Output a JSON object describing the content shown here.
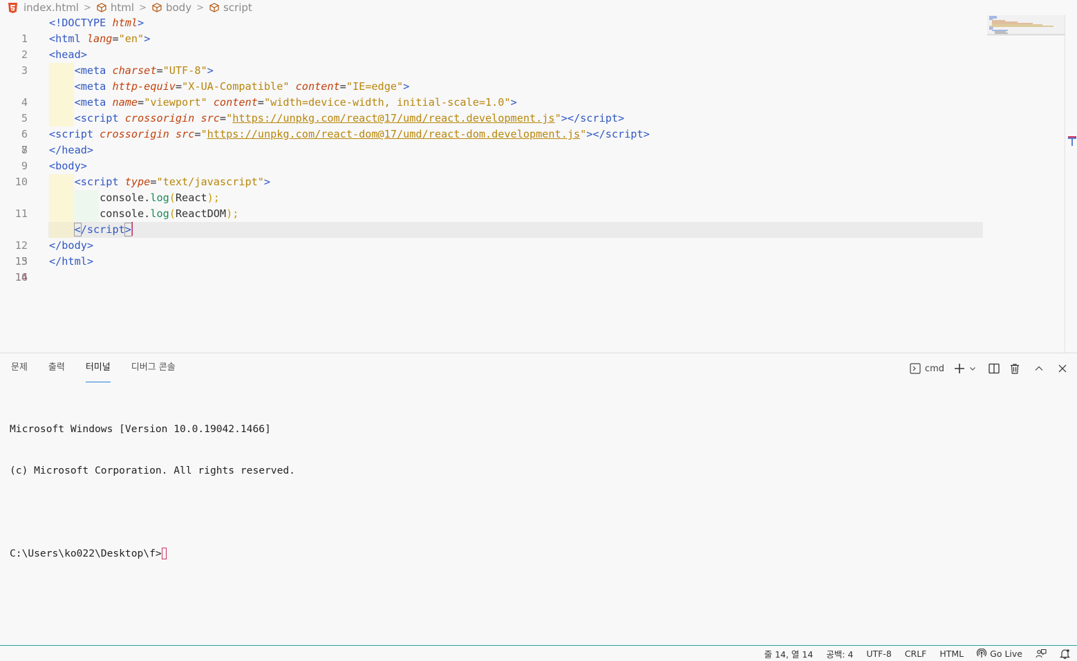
{
  "breadcrumb": {
    "file": "index.html",
    "items": [
      "html",
      "body",
      "script"
    ]
  },
  "editor": {
    "active_line": 14,
    "line_numbers": [
      "1",
      "2",
      "3",
      "4",
      "5",
      "6",
      "7",
      "8",
      "9",
      "10",
      "11",
      "12",
      "13",
      "14",
      "15",
      "16"
    ]
  },
  "panel": {
    "tabs": [
      "문제",
      "출력",
      "터미널",
      "디버그 콘솔"
    ],
    "active_tab": "터미널",
    "shell_name": "cmd",
    "terminal_lines": [
      "Microsoft Windows [Version 10.0.19042.1466]",
      "(c) Microsoft Corporation. All rights reserved.",
      "",
      "C:\\Users\\ko022\\Desktop\\f>"
    ]
  },
  "statusbar": {
    "position": "줄 14, 열 14",
    "indent": "공백: 4",
    "encoding": "UTF-8",
    "eol": "CRLF",
    "language": "HTML",
    "go_live": "Go Live"
  },
  "colors": {
    "tag": "#2f57c4",
    "attribute": "#c2410c",
    "string": "#b8860b",
    "active_line_number": "#c0306a",
    "status_border": "#2aa198"
  },
  "icons": [
    "html5-icon",
    "cube-icon",
    "terminal-icon",
    "plus-icon",
    "chevron-down-icon",
    "split-icon",
    "trash-icon",
    "chevron-up-icon",
    "close-icon",
    "broadcast-icon",
    "feedback-icon",
    "bell-icon"
  ]
}
